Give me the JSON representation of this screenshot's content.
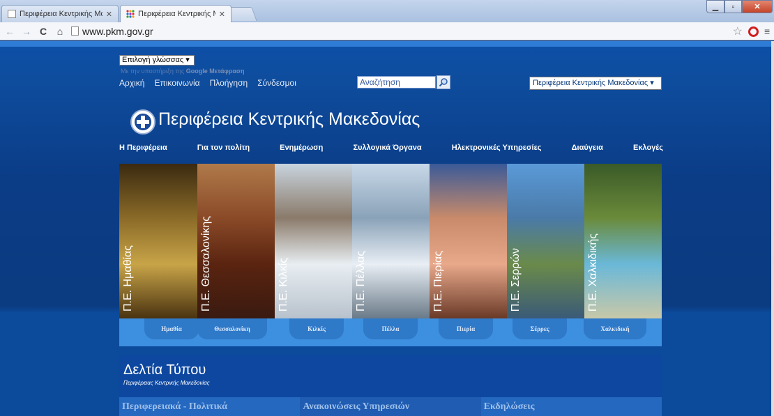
{
  "browser": {
    "tabs": [
      {
        "title": "Περιφέρεια Κεντρικής Μα"
      },
      {
        "title": "Περιφέρεια Κεντρικής Μα"
      }
    ],
    "url": "www.pkm.gov.gr"
  },
  "header": {
    "language_select": "Επιλογή γλώσσας",
    "translate_powered": "Με την υποστήριξη της",
    "translate_google": "Google",
    "translate_word": "Μετάφραση",
    "top_links": [
      "Αρχική",
      "Επικοινωνία",
      "Πλοήγηση",
      "Σύνδεσμοι"
    ],
    "search_placeholder": "Αναζήτηση",
    "region_select": "Περιφέρεια Κεντρικής Μακεδονίας",
    "brand": "Περιφέρεια Κεντρικής Μακεδονίας"
  },
  "main_nav": [
    "Η Περιφέρεια",
    "Για τον πολίτη",
    "Ενημέρωση",
    "Συλλογικά Όργανα",
    "Ηλεκτρονικές Υπηρεσίες",
    "Διαύγεια",
    "Εκλογές"
  ],
  "banner_strips": [
    {
      "label": "Π.Ε. Ημαθίας",
      "colors": [
        "#3a2a10",
        "#8a6a28",
        "#c8a448",
        "#4a3310"
      ]
    },
    {
      "label": "Π.Ε. Θεσσαλονίκης",
      "colors": [
        "#b07a4a",
        "#8a4a28",
        "#5a2410",
        "#3a1a10"
      ]
    },
    {
      "label": "Π.Ε. Κιλκίς",
      "colors": [
        "#c8d4de",
        "#8a7a6a",
        "#e8eef2",
        "#b8c2cc"
      ]
    },
    {
      "label": "Π.Ε. Πέλλας",
      "colors": [
        "#c8d8e8",
        "#8aa2b8",
        "#e8eef4",
        "#6a7a88"
      ]
    },
    {
      "label": "Π.Ε. Πιερίας",
      "colors": [
        "#3a5a98",
        "#c88a6a",
        "#e8a88a",
        "#6a3a28"
      ]
    },
    {
      "label": "Π.Ε. Σερρών",
      "colors": [
        "#5a9ad8",
        "#4a7aa8",
        "#6a8a4a",
        "#3a5a78"
      ]
    },
    {
      "label": "Π.Ε. Χαλκιδικής",
      "colors": [
        "#3a5a28",
        "#6a8a3a",
        "#6ab8d8",
        "#c8c8a8"
      ]
    }
  ],
  "region_tabs": [
    "Ημαθία",
    "Θεσσαλονίκη",
    "Κιλκίς",
    "Πέλλα",
    "Πιερία",
    "Σέρρες",
    "Χαλκιδική"
  ],
  "press": {
    "title": "Δελτία Τύπου",
    "subtitle": "Περιφέρειας Κεντρικής Μακεδονίας"
  },
  "categories": [
    "Περιφερειακά - Πολιτικά",
    "Ανακοινώσεις Υπηρεσιών",
    "Εκδηλώσεις"
  ]
}
